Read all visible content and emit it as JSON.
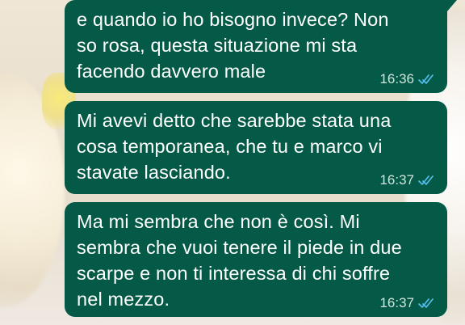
{
  "messages": [
    {
      "text": "e quando io ho bisogno invece? Non\nso rosa, questa situazione mi sta\nfacendo davvero male",
      "time": "16:36",
      "status_icon": "double-check-read-icon"
    },
    {
      "text": "Mi avevi detto che sarebbe stata una\ncosa temporanea, che tu e marco vi\nstavate lasciando.",
      "time": "16:37",
      "status_icon": "double-check-read-icon"
    },
    {
      "text": "Ma mi sembra che non è così. Mi\nsembra che vuoi tenere il piede in due\nscarpe e non ti interessa di chi soffre\nnel mezzo.",
      "time": "16:37",
      "status_icon": "double-check-read-icon"
    }
  ],
  "colors": {
    "outgoing_bubble": "#045a47",
    "message_text": "#ffffff",
    "timestamp": "#d4e3dd",
    "read_ticks": "#53bdeb"
  }
}
